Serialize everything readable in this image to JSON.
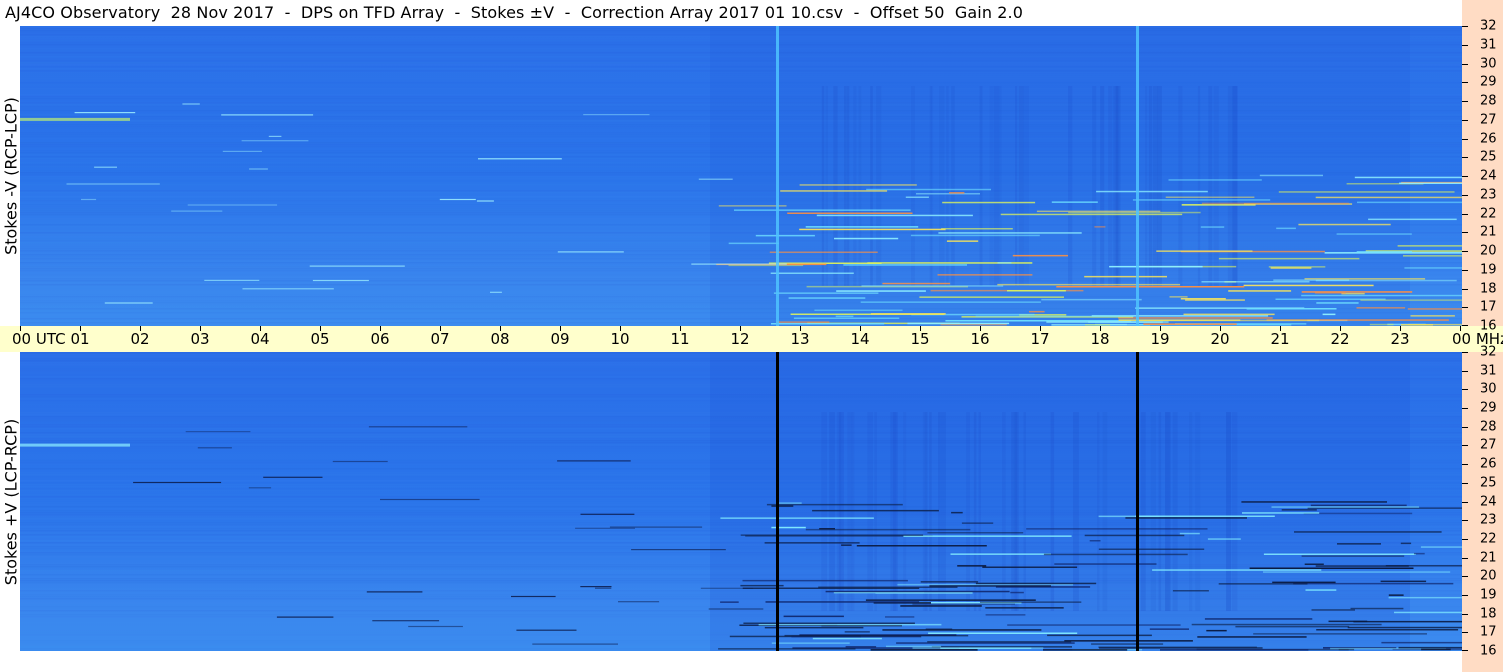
{
  "title": "AJ4CO Observatory  28 Nov 2017  -  DPS on TFD Array  -  Stokes ±V  -  Correction Array 2017 01 10.csv  -  Offset 50  Gain 2.0",
  "chart_data": [
    {
      "type": "heatmap",
      "ylabel": "Stokes -V (RCP-LCP)",
      "y_unit": "MHz",
      "x_ticks": [
        "00 UTC",
        "01",
        "02",
        "03",
        "04",
        "05",
        "06",
        "07",
        "08",
        "09",
        "10",
        "11",
        "12",
        "13",
        "14",
        "15",
        "16",
        "17",
        "18",
        "19",
        "20",
        "21",
        "22",
        "23",
        "00 MHz"
      ],
      "y_ticks": [
        32,
        31,
        30,
        29,
        28,
        27,
        26,
        25,
        24,
        23,
        22,
        21,
        20,
        19,
        18,
        17,
        16
      ],
      "xlim_hours": [
        0,
        24
      ],
      "ylim_mhz": [
        16,
        32
      ],
      "vertical_lines_utc_hours": [
        12.6,
        18.6
      ],
      "vertical_line_color": "#4fc3ff",
      "colors": {
        "background": "#2a6fe6",
        "low": "#1f55d8",
        "high": "#f0e060"
      }
    },
    {
      "type": "heatmap",
      "ylabel": "Stokes +V (LCP-RCP)",
      "y_unit": "MHz",
      "x_ticks": [
        "00 UTC",
        "01",
        "02",
        "03",
        "04",
        "05",
        "06",
        "07",
        "08",
        "09",
        "10",
        "11",
        "12",
        "13",
        "14",
        "15",
        "16",
        "17",
        "18",
        "19",
        "20",
        "21",
        "22",
        "23",
        "00 MHz"
      ],
      "y_ticks": [
        32,
        31,
        30,
        29,
        28,
        27,
        26,
        25,
        24,
        23,
        22,
        21,
        20,
        19,
        18,
        17,
        16
      ],
      "xlim_hours": [
        0,
        24
      ],
      "ylim_mhz": [
        16,
        32
      ],
      "vertical_lines_utc_hours": [
        12.6,
        18.6
      ],
      "vertical_line_color": "#000000",
      "colors": {
        "background": "#2a6fe6",
        "low": "#1f55d8",
        "high": "#0a1a40"
      }
    }
  ]
}
